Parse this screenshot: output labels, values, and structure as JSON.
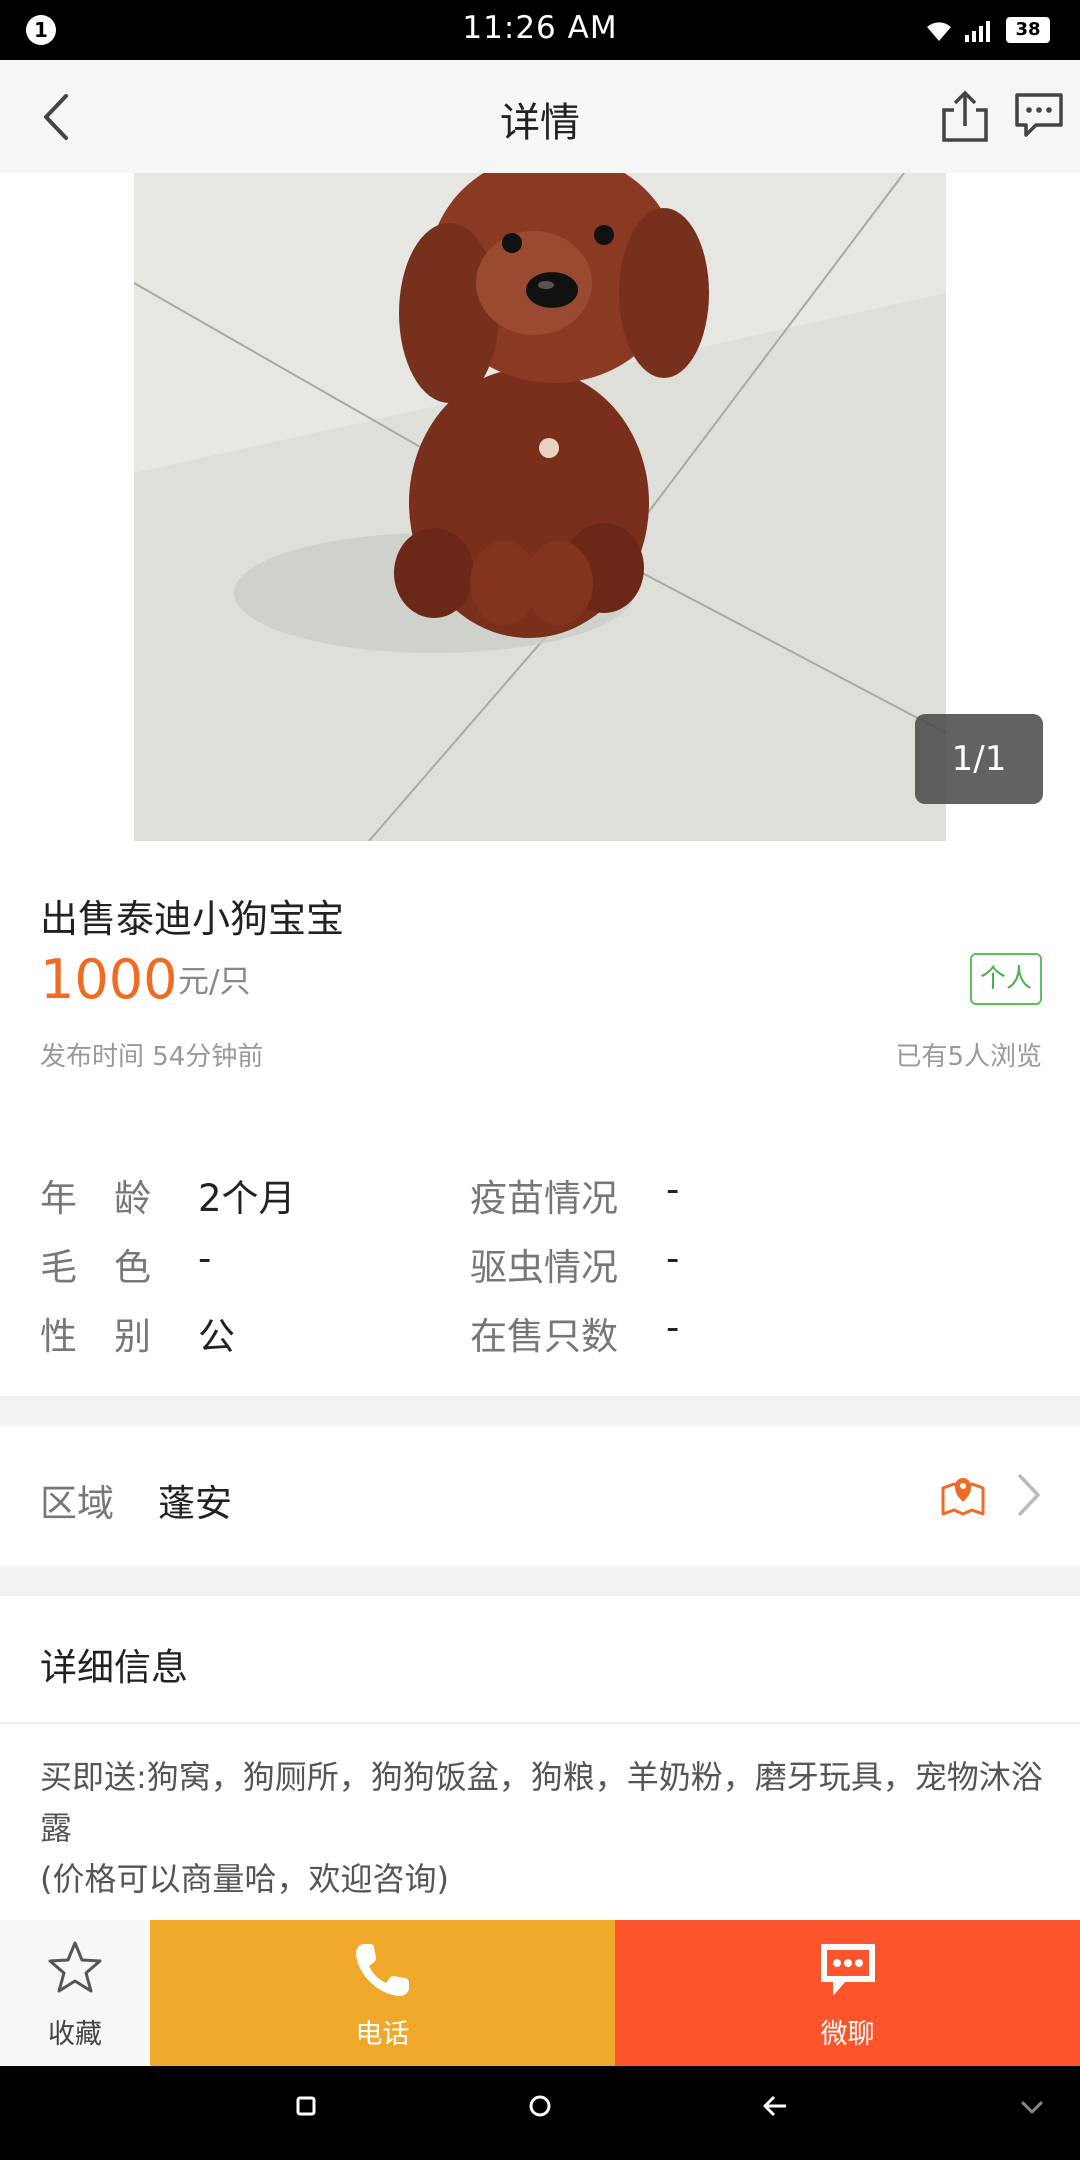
{
  "status_bar": {
    "notification_count": "1",
    "time": "11:26 AM",
    "battery": "38",
    "icons": [
      "wifi-icon",
      "signal-icon",
      "battery-icon"
    ]
  },
  "header": {
    "title": "详情",
    "icons": [
      "back-arrow-icon",
      "share-icon",
      "message-icon"
    ]
  },
  "gallery": {
    "counter": "1/1"
  },
  "listing": {
    "title": "出售泰迪小狗宝宝",
    "price": "1000",
    "price_unit": "元/只",
    "seller_type": "个人",
    "post_time": "发布时间 54分钟前",
    "view_count": "已有5人浏览"
  },
  "attributes": [
    {
      "label": "年　龄",
      "value": "2个月"
    },
    {
      "label": "疫苗情况",
      "value": "-"
    },
    {
      "label": "毛　色",
      "value": "-"
    },
    {
      "label": "驱虫情况",
      "value": "-"
    },
    {
      "label": "性　别",
      "value": "公"
    },
    {
      "label": "在售只数",
      "value": "-"
    }
  ],
  "region": {
    "label": "区域",
    "value": "蓬安"
  },
  "details": {
    "heading": "详细信息",
    "line1": "买即送:狗窝，狗厕所，狗狗饭盆，狗粮，羊奶粉，磨牙玩具，宠物沐浴露",
    "line2": "(价格可以商量哈，欢迎咨询)"
  },
  "actions": {
    "favorite": "收藏",
    "call": "电话",
    "chat": "微聊"
  },
  "colors": {
    "accent_orange": "#f26a21",
    "call_button": "#f0a82a",
    "chat_button": "#fd542c",
    "seller_tag_green": "#5cbf5c"
  }
}
